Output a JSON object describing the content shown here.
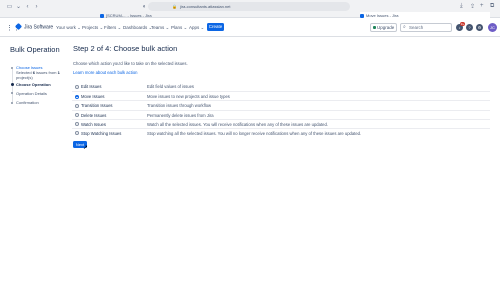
{
  "browser": {
    "address": "jira-consultants.atlassian.net",
    "tabs": [
      {
        "label": "[SCRUM-... - Issues - Jira"
      },
      {
        "label": "Move Issues - Jira"
      }
    ]
  },
  "header": {
    "brand": "Jira Software",
    "nav": [
      "Your work",
      "Projects",
      "Filters",
      "Dashboards",
      "Teams",
      "Plans",
      "Apps"
    ],
    "create_label": "Create",
    "upgrade_label": "Upgrade",
    "search_placeholder": "Search",
    "notification_count": "9+",
    "avatar_initials": "JC"
  },
  "sidebar": {
    "title": "Bulk Operation",
    "steps": [
      {
        "label": "Choose Issues",
        "state": "done"
      },
      {
        "label": "Choose Operation",
        "state": "current"
      },
      {
        "label": "Operation Details",
        "state": "todo"
      },
      {
        "label": "Confirmation",
        "state": "todo"
      }
    ],
    "selected_prefix": "Selected",
    "selected_count": "6",
    "selected_mid": "issues from",
    "project_count": "1",
    "selected_suffix": "project(s)"
  },
  "main": {
    "title": "Step 2 of 4: Choose bulk action",
    "intro": "Choose which action you'd like to take on the selected issues.",
    "learn_more": "Learn more about each bulk action",
    "options": [
      {
        "name": "Edit Issues",
        "desc": "Edit field values of issues",
        "selected": false
      },
      {
        "name": "Move Issues",
        "desc": "Move issues to new projects and issue types",
        "selected": true
      },
      {
        "name": "Transition Issues",
        "desc": "Transition issues through workflow",
        "selected": false
      },
      {
        "name": "Delete Issues",
        "desc": "Permanently delete issues from Jira",
        "selected": false
      },
      {
        "name": "Watch Issues",
        "desc": "Watch all the selected issues. You will receive notifications when any of these issues are updated.",
        "selected": false
      },
      {
        "name": "Stop Watching Issues",
        "desc": "Stop watching all the selected issues. You will no longer receive notifications when any of these issues are updated.",
        "selected": false
      }
    ],
    "next_label": "Next"
  },
  "colors": {
    "accent": "#0c66e4",
    "text": "#172b4d",
    "subtle": "#44546f"
  }
}
